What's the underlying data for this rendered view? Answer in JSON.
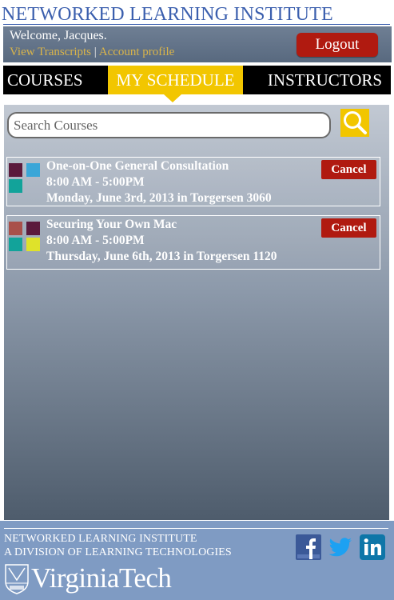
{
  "site": {
    "title": "Networked Learning Institute"
  },
  "header": {
    "welcome": "Welcome, Jacques.",
    "links": [
      {
        "label": "View Transcripts"
      },
      {
        "label": "Account profile"
      }
    ],
    "separator": "|",
    "logout_label": "Logout"
  },
  "nav": {
    "tabs": [
      {
        "label": "COURSES",
        "active": false
      },
      {
        "label": "MY SCHEDULE",
        "active": true
      },
      {
        "label": "INSTRUCTORS",
        "active": false
      }
    ]
  },
  "search": {
    "placeholder": "Search Courses",
    "value": "",
    "icon": "search-icon"
  },
  "schedule": {
    "items": [
      {
        "title": "One-on-One General Consultation",
        "time": "8:00 AM - 5:00PM",
        "when_where": "Monday, June 3rd, 2013 in Torgersen 3060",
        "cancel_label": "Cancel",
        "swatches": [
          "#5b1a3c",
          "#3aa6d8",
          "#12a39a"
        ]
      },
      {
        "title": "Securing Your Own Mac",
        "time": "8:00 AM - 5:00PM",
        "when_where": "Thursday, June 6th, 2013 in Torgersen 1120",
        "cancel_label": "Cancel",
        "swatches": [
          "#a9504a",
          "#5b1a3c",
          "#12a39a",
          "#dfe22a"
        ]
      }
    ]
  },
  "footer": {
    "line1": "Networked Learning Institute",
    "line2": "A Division of Learning Technologies",
    "logo_text": "VirginiaTech",
    "social": [
      "facebook-icon",
      "twitter-icon",
      "linkedin-icon"
    ]
  },
  "colors": {
    "brand_blue": "#3b5fae",
    "accent_yellow": "#f2c600",
    "cancel_red": "#b01a10",
    "link_gold": "#d9b44a"
  }
}
